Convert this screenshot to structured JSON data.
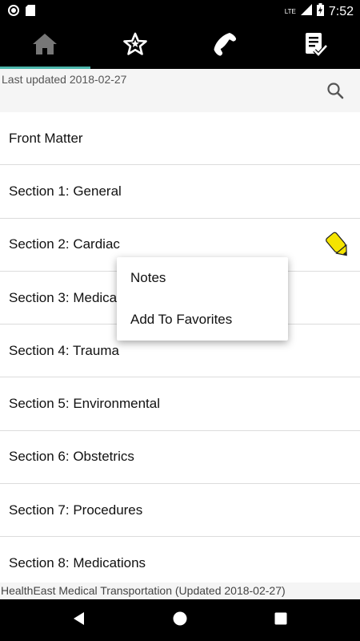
{
  "status_bar": {
    "time": "7:52",
    "network": "LTE",
    "icons": [
      "record-icon",
      "sd-card-icon",
      "signal-icon",
      "battery-charging-icon"
    ]
  },
  "tabs": [
    {
      "name": "home",
      "icon": "home-icon",
      "active": true
    },
    {
      "name": "favorites",
      "icon": "star-icon",
      "active": false
    },
    {
      "name": "phone",
      "icon": "phone-icon",
      "active": false
    },
    {
      "name": "checklist",
      "icon": "checklist-icon",
      "active": false
    }
  ],
  "header": {
    "last_updated": "Last updated 2018-02-27",
    "search_icon": "search-icon"
  },
  "sections": [
    {
      "label": "Front Matter"
    },
    {
      "label": "Section 1: General"
    },
    {
      "label": "Section 2: Cardiac"
    },
    {
      "label": "Section 3: Medical"
    },
    {
      "label": "Section 4: Trauma"
    },
    {
      "label": "Section 5: Environmental"
    },
    {
      "label": "Section 6: Obstetrics"
    },
    {
      "label": "Section 7: Procedures"
    },
    {
      "label": "Section 8: Medications"
    }
  ],
  "context_menu": {
    "items": [
      {
        "label": "Notes"
      },
      {
        "label": "Add To Favorites"
      }
    ]
  },
  "footer": {
    "text": "HealthEast Medical Transportation (Updated 2018-02-27)"
  },
  "colors": {
    "accent": "#4db6ac",
    "pencil": "#f5e400",
    "bar_bg": "#000000"
  }
}
